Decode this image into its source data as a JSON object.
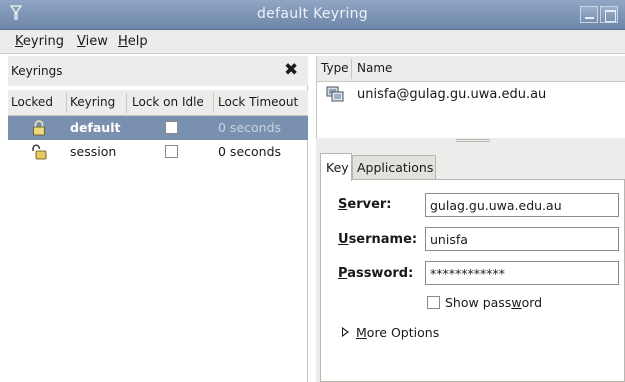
{
  "window": {
    "title": "default Keyring",
    "app_icon": "keyring-app-icon"
  },
  "menubar": [
    {
      "label": "Keyring",
      "mnemonic": "K",
      "rest": "eyring"
    },
    {
      "label": "View",
      "mnemonic": "V",
      "rest": "iew"
    },
    {
      "label": "Help",
      "mnemonic": "H",
      "rest": "elp"
    }
  ],
  "keyrings_pane": {
    "title": "Keyrings",
    "close_glyph": "✖",
    "columns": [
      "Locked",
      "Keyring",
      "Lock on Idle",
      "Lock Timeout"
    ],
    "rows": [
      {
        "locked_icon": "locked-padlock-icon",
        "name": "default",
        "lock_on_idle": false,
        "timeout": "0 seconds",
        "selected": true
      },
      {
        "locked_icon": "unlocked-padlock-icon",
        "name": "session",
        "lock_on_idle": false,
        "timeout": "0 seconds",
        "selected": false
      }
    ]
  },
  "items_pane": {
    "columns": [
      "Type",
      "Name"
    ],
    "items": [
      {
        "type_icon": "network-password-icon",
        "name": "unisfa@gulag.gu.uwa.edu.au"
      }
    ]
  },
  "details": {
    "tabs": [
      {
        "label": "Key",
        "active": true
      },
      {
        "label": "Applications",
        "active": false
      }
    ],
    "server": {
      "label_mnemonic": "S",
      "label_rest": "erver:",
      "value": "gulag.gu.uwa.edu.au"
    },
    "username": {
      "label_mnemonic": "U",
      "label_rest": "sername:",
      "value": "unisfa"
    },
    "password": {
      "label_mnemonic": "P",
      "label_rest": "assword:",
      "value": "************"
    },
    "show_password": {
      "pre": "Show pass",
      "mnemonic": "w",
      "post": "ord",
      "checked": false
    },
    "more_options": {
      "mnemonic": "M",
      "rest": "ore Options"
    }
  },
  "colors": {
    "selection": "#7a90b1",
    "titlebar": "#7f97b8",
    "chrome": "#edecea"
  }
}
